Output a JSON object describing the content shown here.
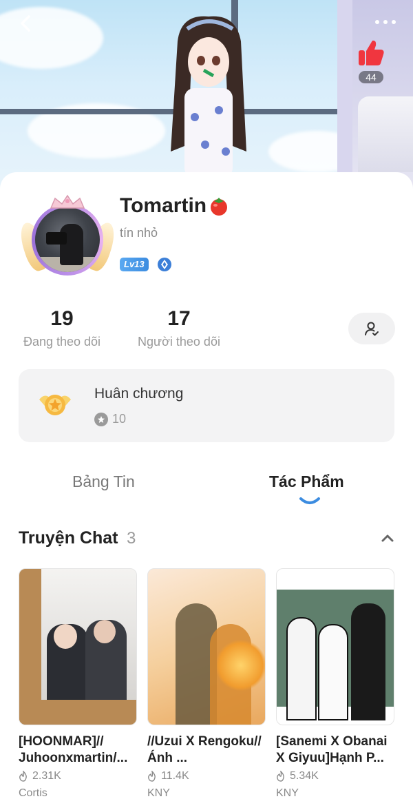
{
  "header": {
    "like_count": "44"
  },
  "profile": {
    "name": "Tomartin",
    "bio": "tín nhỏ",
    "level": "Lv13"
  },
  "stats": {
    "following_count": "19",
    "following_label": "Đang theo dõi",
    "followers_count": "17",
    "followers_label": "Người theo dõi"
  },
  "medals": {
    "title": "Huân chương",
    "count": "10"
  },
  "tabs": [
    {
      "label": "Bảng Tin",
      "active": false
    },
    {
      "label": "Tác Phẩm",
      "active": true
    }
  ],
  "section": {
    "title": "Truyện Chat",
    "count": "3"
  },
  "stories": [
    {
      "title": "[HOONMAR]// Juhoonxmartin/...",
      "views": "2.31K",
      "tag": "Cortis"
    },
    {
      "title": "//Uzui X Rengoku// Ánh ...",
      "views": "11.4K",
      "tag": "KNY"
    },
    {
      "title": "[Sanemi X Obanai X Giyuu]Hạnh P...",
      "views": "5.34K",
      "tag": "KNY"
    }
  ],
  "colors": {
    "accent_blue": "#3c8ce0",
    "like_red": "#f0363f",
    "tab_indicator": "#3c8ce0"
  }
}
